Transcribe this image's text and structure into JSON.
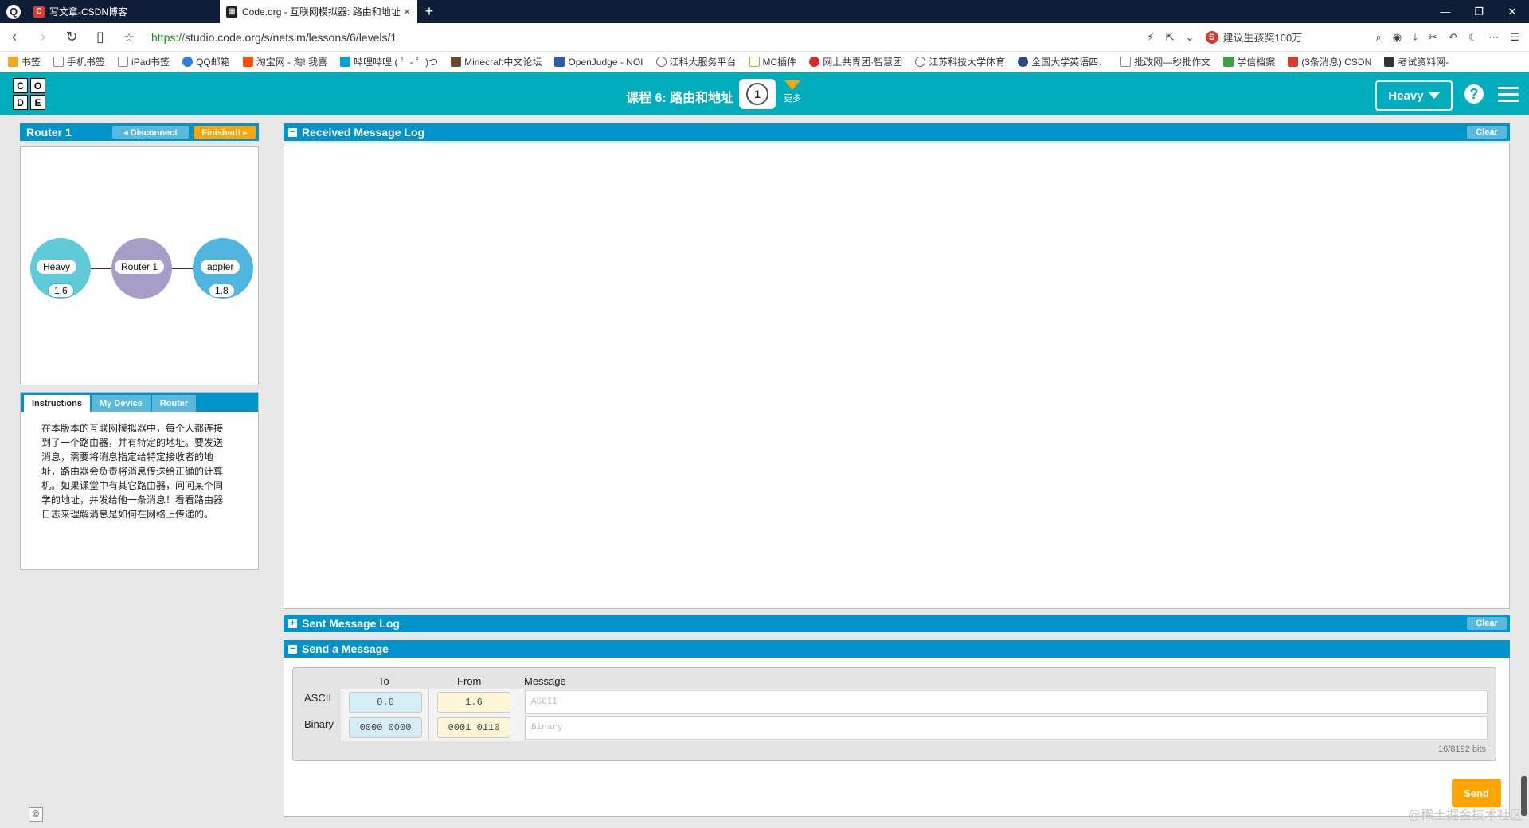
{
  "browser": {
    "tabs": [
      {
        "label": "写文章-CSDN博客",
        "favicon": "csdn-icon"
      },
      {
        "label": "Code.org - 互联网模拟器: 路由和地址",
        "favicon": "codeorg-icon",
        "active": true
      }
    ],
    "url_scheme": "https://",
    "url_rest": "studio.code.org/s/netsim/lessons/6/levels/1",
    "search_hint": "建议生孩奖100万",
    "bookmarks": [
      "书签",
      "手机书签",
      "iPad书签",
      "QQ邮箱",
      "淘宝网 - 淘! 我喜",
      "哔哩哔哩 ( ゜- ゜)つ",
      "Minecraft中文论坛",
      "OpenJudge - NOI",
      "江科大服务平台",
      "MC插件",
      "网上共青团·智慧团",
      "江苏科技大学体育",
      "全国大学英语四、",
      "批改网—秒批作文",
      "学信档案",
      "(3条消息) CSDN",
      "考试资料网-"
    ]
  },
  "header": {
    "logo_letters": [
      "C",
      "O",
      "D",
      "E"
    ],
    "lesson_title": "课程 6: 路由和地址",
    "level_number": "1",
    "more_label": "更多",
    "user_name": "Heavy",
    "help_glyph": "?"
  },
  "router_panel": {
    "title": "Router 1",
    "disconnect_label": "◂ Disconnect",
    "finished_label": "Finished! ▸"
  },
  "network": {
    "nodes": [
      {
        "name": "Heavy",
        "address": "1.6",
        "color": "#5fcbd8"
      },
      {
        "name": "Router 1",
        "address": "",
        "color": "#a89cc8"
      },
      {
        "name": "appler",
        "address": "1.8",
        "color": "#4fb6e0"
      }
    ]
  },
  "info_tabs": {
    "tabs": [
      "Instructions",
      "My Device",
      "Router"
    ],
    "active": "Instructions",
    "instructions": "在本版本的互联网模拟器中，每个人都连接到了一个路由器，并有特定的地址。要发送消息，需要将消息指定给特定接收者的地址，路由器会负责将消息传送给正确的计算机。如果课堂中有其它路由器，问问某个同学的地址，并发给他一条消息！看看路由器日志来理解消息是如何在网络上传递的。"
  },
  "received_log": {
    "title": "Received Message Log",
    "clear_label": "Clear"
  },
  "sent_log": {
    "title": "Sent Message Log",
    "clear_label": "Clear"
  },
  "send_message": {
    "title": "Send a Message",
    "col_to": "To",
    "col_from": "From",
    "col_message": "Message",
    "row_ascii": "ASCII",
    "row_binary": "Binary",
    "to_ascii": "0.0",
    "from_ascii": "1.6",
    "to_binary": "0000 0000",
    "from_binary": "0001 0110",
    "message_ascii_placeholder": "ASCII",
    "message_binary_placeholder": "Binary",
    "bits_counter": "16/8192 bits",
    "send_label": "Send"
  },
  "footer": {
    "copyright_glyph": "©",
    "watermark": "@稀土掘金技术社区"
  },
  "colors": {
    "header_teal": "#00adbc",
    "panel_blue": "#0094ca",
    "accent_orange": "#ffa400"
  }
}
